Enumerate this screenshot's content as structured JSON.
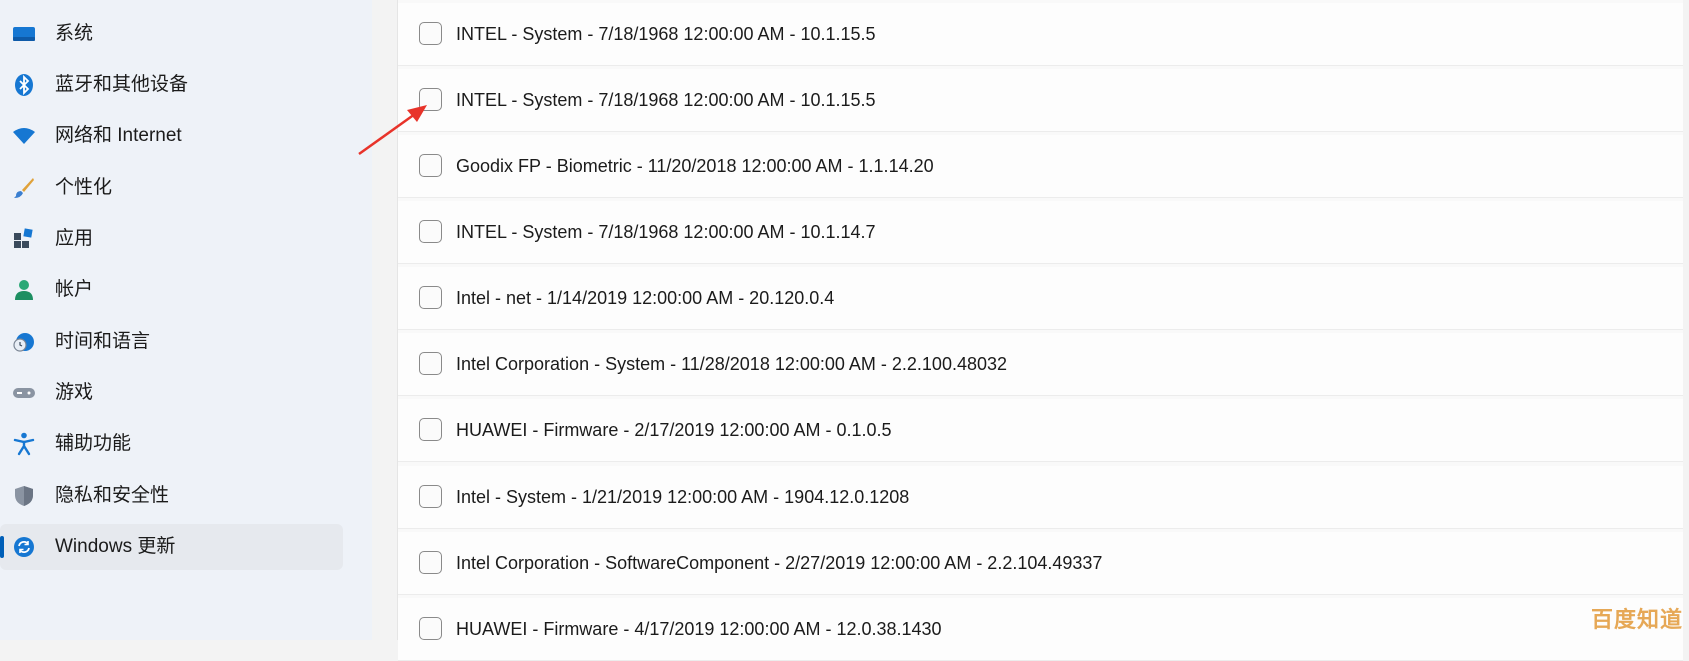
{
  "sidebar": {
    "items": [
      {
        "label": "系统",
        "icon": "monitor-icon",
        "active": false
      },
      {
        "label": "蓝牙和其他设备",
        "icon": "bluetooth-icon",
        "active": false
      },
      {
        "label": "网络和 Internet",
        "icon": "wifi-icon",
        "active": false
      },
      {
        "label": "个性化",
        "icon": "paintbrush-icon",
        "active": false
      },
      {
        "label": "应用",
        "icon": "apps-icon",
        "active": false
      },
      {
        "label": "帐户",
        "icon": "person-icon",
        "active": false
      },
      {
        "label": "时间和语言",
        "icon": "globe-clock-icon",
        "active": false
      },
      {
        "label": "游戏",
        "icon": "gamepad-icon",
        "active": false
      },
      {
        "label": "辅助功能",
        "icon": "accessibility-icon",
        "active": false
      },
      {
        "label": "隐私和安全性",
        "icon": "shield-icon",
        "active": false
      },
      {
        "label": "Windows 更新",
        "icon": "sync-icon",
        "active": true
      }
    ]
  },
  "updates": {
    "items": [
      {
        "label": "INTEL - System - 7/18/1968 12:00:00 AM - 10.1.15.5",
        "checked": false
      },
      {
        "label": "INTEL - System - 7/18/1968 12:00:00 AM - 10.1.15.5",
        "checked": false
      },
      {
        "label": "Goodix FP - Biometric - 11/20/2018 12:00:00 AM - 1.1.14.20",
        "checked": false
      },
      {
        "label": "INTEL - System - 7/18/1968 12:00:00 AM - 10.1.14.7",
        "checked": false
      },
      {
        "label": "Intel - net - 1/14/2019 12:00:00 AM - 20.120.0.4",
        "checked": false
      },
      {
        "label": "Intel Corporation - System - 11/28/2018 12:00:00 AM - 2.2.100.48032",
        "checked": false
      },
      {
        "label": "HUAWEI - Firmware - 2/17/2019 12:00:00 AM - 0.1.0.5",
        "checked": false
      },
      {
        "label": "Intel - System - 1/21/2019 12:00:00 AM - 1904.12.0.1208",
        "checked": false
      },
      {
        "label": "Intel Corporation - SoftwareComponent - 2/27/2019 12:00:00 AM - 2.2.104.49337",
        "checked": false
      },
      {
        "label": "HUAWEI - Firmware - 4/17/2019 12:00:00 AM - 12.0.38.1430",
        "checked": false
      }
    ]
  },
  "annotation": {
    "arrow_color": "#e8332a",
    "points_to": "updates.items.1"
  },
  "watermark": {
    "text": "百度知道"
  },
  "colors": {
    "accent": "#005fb8",
    "sidebar_bg": "#eef2f8",
    "content_bg": "#f9f9f9"
  }
}
